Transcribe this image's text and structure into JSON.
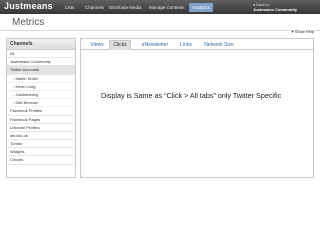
{
  "topbar": {
    "logo": "Justmeans",
    "nav": [
      "Lists",
      "Channels",
      "Distribute Media",
      "Manage Contents",
      "Analytics"
    ],
    "active_nav": "Analytics",
    "community_back": "◂ Back to",
    "community_name": "Justmeans Community"
  },
  "page": {
    "title": "Metrics",
    "help": "Show Help"
  },
  "sidebar": {
    "header": "Channels",
    "items": [
      {
        "label": "All",
        "level": 0
      },
      {
        "label": "Justmeans Community",
        "level": 0
      },
      {
        "label": "Twitter Accounts",
        "level": 0,
        "selected": true
      },
      {
        "label": "- Martin Smith",
        "level": 1
      },
      {
        "label": "- Kevin Long",
        "level": 1
      },
      {
        "label": "- Justmeaning",
        "level": 1
      },
      {
        "label": "- Deb Berman",
        "level": 1
      },
      {
        "label": "Facebook Profiles",
        "level": 0
      },
      {
        "label": "Facebook Pages",
        "level": 0
      },
      {
        "label": "LinkedIn Profiles",
        "level": 0
      },
      {
        "label": "del.icio.us",
        "level": 0
      },
      {
        "label": "Tumblr",
        "level": 0
      },
      {
        "label": "Widgets",
        "level": 0
      },
      {
        "label": "Circuits",
        "level": 0
      }
    ]
  },
  "tabs": [
    "Views",
    "Clicks",
    "eNewsletter",
    "Links",
    "Network Size"
  ],
  "active_tab": "Clicks",
  "main": {
    "note": "Display is Same as “Click > All tabs”  only Twitter Specific"
  },
  "colors": {
    "topbar": "#3f3f3f",
    "active_nav": "#7fa1c9",
    "tab_link": "#3a67a8"
  }
}
